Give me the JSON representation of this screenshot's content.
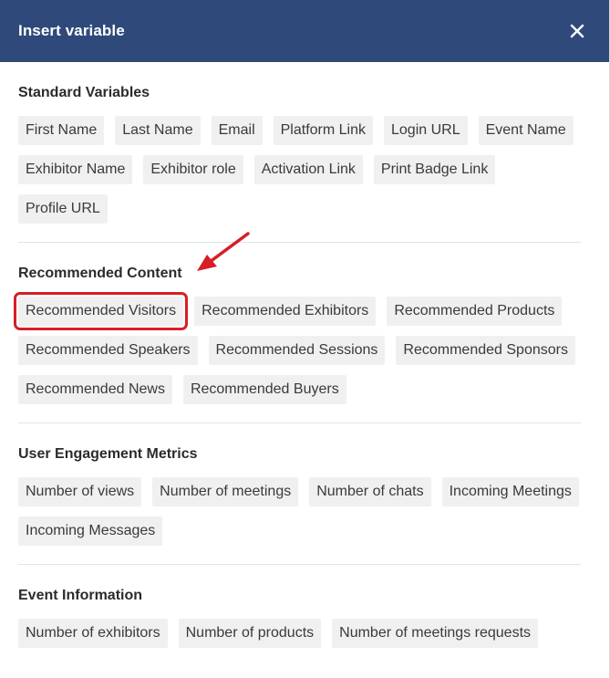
{
  "dialog": {
    "title": "Insert variable",
    "close_symbol": "✕"
  },
  "sections": [
    {
      "title": "Standard Variables",
      "chips": [
        "First Name",
        "Last Name",
        "Email",
        "Platform Link",
        "Login URL",
        "Event Name",
        "Exhibitor Name",
        "Exhibitor role",
        "Activation Link",
        "Print Badge Link",
        "Profile URL"
      ]
    },
    {
      "title": "Recommended Content",
      "chips": [
        "Recommended Visitors",
        "Recommended Exhibitors",
        "Recommended Products",
        "Recommended Speakers",
        "Recommended Sessions",
        "Recommended Sponsors",
        "Recommended News",
        "Recommended Buyers"
      ]
    },
    {
      "title": "User Engagement Metrics",
      "chips": [
        "Number of views",
        "Number of meetings",
        "Number of chats",
        "Incoming Meetings",
        "Incoming Messages"
      ]
    },
    {
      "title": "Event Information",
      "chips": [
        "Number of exhibitors",
        "Number of products",
        "Number of meetings requests"
      ]
    }
  ],
  "annotation": {
    "highlight_color": "#d61f26",
    "icon": "red-arrow-icon"
  },
  "colors": {
    "header_bg": "#2f4a7a",
    "chip_bg": "#f0f0f0"
  }
}
